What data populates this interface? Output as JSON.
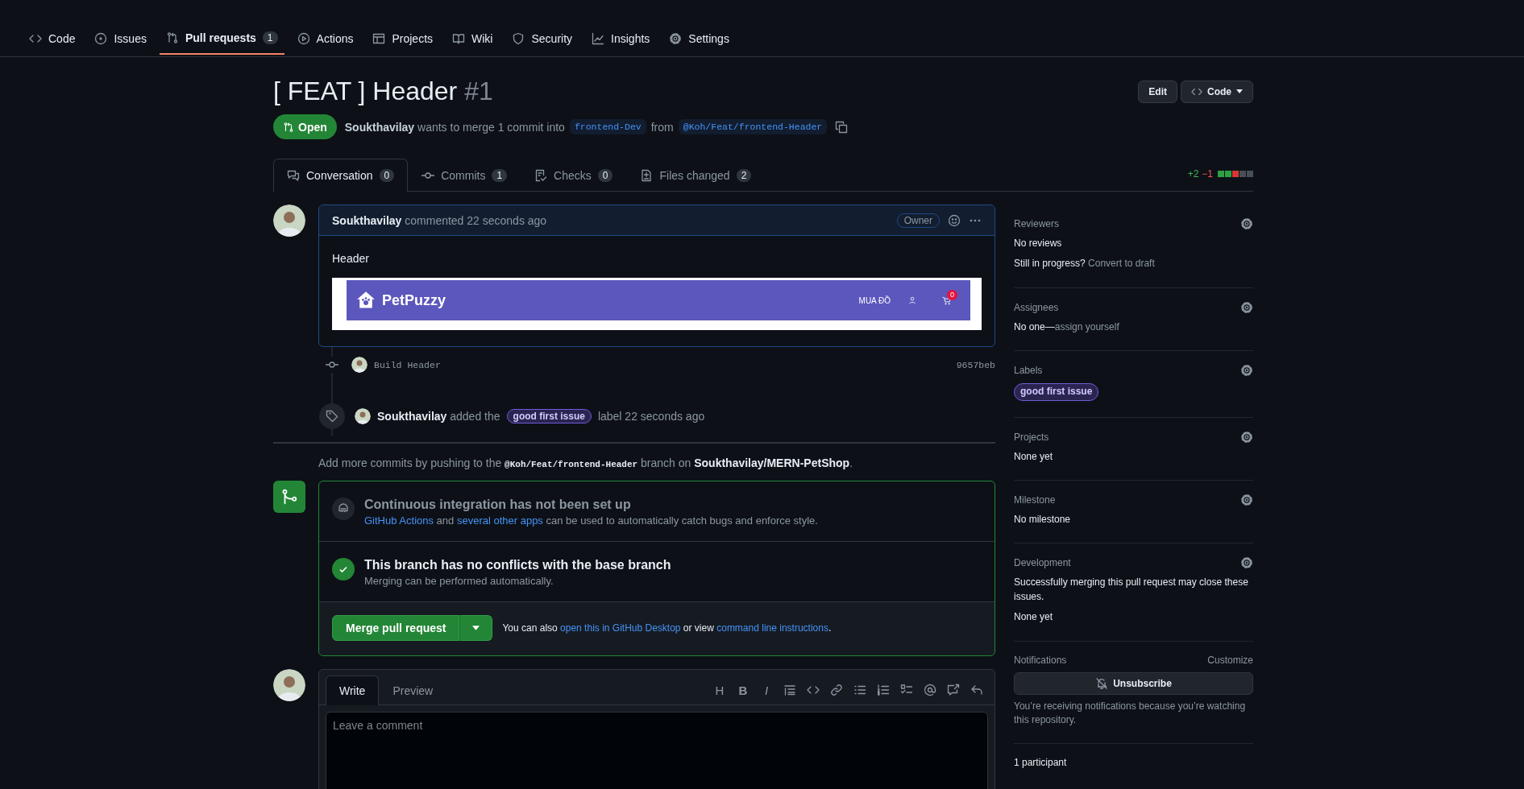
{
  "repo_nav": [
    {
      "label": "Code",
      "selected": false
    },
    {
      "label": "Issues",
      "selected": false
    },
    {
      "label": "Pull requests",
      "selected": true,
      "count": "1"
    },
    {
      "label": "Actions",
      "selected": false
    },
    {
      "label": "Projects",
      "selected": false
    },
    {
      "label": "Wiki",
      "selected": false
    },
    {
      "label": "Security",
      "selected": false
    },
    {
      "label": "Insights",
      "selected": false
    },
    {
      "label": "Settings",
      "selected": false
    }
  ],
  "pr": {
    "title": "[ FEAT ] Header",
    "number": "#1",
    "state": "Open",
    "author": "Soukthavilay",
    "summary": "wants to merge 1 commit into",
    "base": "frontend-Dev",
    "from": "from",
    "head": "@Koh/Feat/frontend-Header",
    "buttons": [
      "Edit",
      "Code"
    ]
  },
  "tabs": [
    {
      "label": "Conversation",
      "count": "0",
      "selected": true
    },
    {
      "label": "Commits",
      "count": "1",
      "selected": false
    },
    {
      "label": "Checks",
      "count": "0",
      "selected": false
    },
    {
      "label": "Files changed",
      "count": "2",
      "selected": false
    }
  ],
  "diff": {
    "additions": "+2",
    "deletions": "−1",
    "blocks": [
      {
        "color": "#2ea043"
      },
      {
        "color": "#2ea043"
      },
      {
        "color": "#da3633"
      },
      {
        "color": "#484f58"
      },
      {
        "color": "#484f58"
      }
    ]
  },
  "comment": {
    "author": "Soukthavilay",
    "action": "commented 22 seconds ago",
    "role": "Owner",
    "body": "Header",
    "screenshot": {
      "brand": "PetPuzzy",
      "link": "MUA ĐỒ",
      "cart_count": "0"
    }
  },
  "commit": {
    "message": "Build Header",
    "sha": "9657beb"
  },
  "label_event": {
    "actor": "Soukthavilay",
    "action": "added the",
    "label": "good first issue",
    "after": "label 22 seconds ago"
  },
  "push_hint": {
    "before": "Add more commits by pushing to the",
    "branch": "@Koh/Feat/frontend-Header",
    "middle": "branch on",
    "repo": "Soukthavilay/MERN-PetShop",
    "end": "."
  },
  "ci": {
    "title": "Continuous integration has not been set up",
    "link1": "GitHub Actions",
    "and": "and",
    "link2": "several other apps",
    "rest": "can be used to automatically catch bugs and enforce style."
  },
  "conflicts": {
    "title": "This branch has no conflicts with the base branch",
    "desc": "Merging can be performed automatically."
  },
  "merge": {
    "button": "Merge pull request",
    "before": "You can also",
    "link1": "open this in GitHub Desktop",
    "or": "or view",
    "link2": "command line instructions",
    "end": "."
  },
  "editor": {
    "tabs": [
      {
        "label": "Write",
        "selected": true
      },
      {
        "label": "Preview",
        "selected": false
      }
    ],
    "glyphs": [
      "H",
      "B",
      "I"
    ],
    "placeholder": "Leave a comment"
  },
  "sidebar": {
    "reviewers": {
      "title": "Reviewers",
      "value": "No reviews",
      "hint": "Still in progress?",
      "hint_link": "Convert to draft"
    },
    "assignees": {
      "title": "Assignees",
      "value": "No one—",
      "link": "assign yourself"
    },
    "labels": {
      "title": "Labels",
      "items": [
        "good first issue"
      ]
    },
    "projects": {
      "title": "Projects",
      "value": "None yet"
    },
    "milestone": {
      "title": "Milestone",
      "value": "No milestone"
    },
    "development": {
      "title": "Development",
      "text": "Successfully merging this pull request may close these issues.",
      "value": "None yet"
    },
    "notifications": {
      "title": "Notifications",
      "customize": "Customize",
      "button": "Unsubscribe",
      "note": "You’re receiving notifications because you’re watching this repository."
    },
    "participants": {
      "title": "1 participant"
    }
  }
}
